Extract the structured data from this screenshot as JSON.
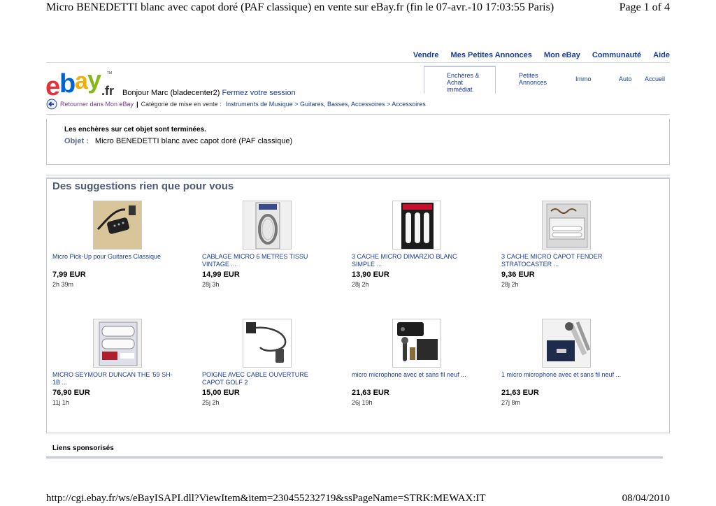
{
  "print": {
    "title": "Micro BENEDETTI blanc avec capot doré (PAF classique) en vente sur eBay.fr (fin le 07-avr.-10 17:03:55 Paris)",
    "page": "Page 1 of 4",
    "url": "http://cgi.ebay.fr/ws/eBayISAPI.dll?ViewItem&item=230455232719&ssPageName=STRK:MEWAX:IT",
    "date": "08/04/2010"
  },
  "topnav": {
    "sell": "Vendre",
    "my_listings": "Mes Petites Annonces",
    "my_ebay": "Mon eBay",
    "community": "Communauté",
    "help": "Aide"
  },
  "subnav": {
    "auctions_1": "Enchères &",
    "auctions_2": "Achat",
    "auctions_3": "immédiat",
    "classifieds_1": "Petites",
    "classifieds_2": "Annonces",
    "immo": "Immo",
    "auto": "Auto",
    "home": "Accueil"
  },
  "logo": {
    "text": "ebay.fr",
    "colors": {
      "e": "#e53238",
      "b": "#0064d2",
      "a": "#f5af02",
      "y": "#86b817"
    }
  },
  "greeting": {
    "hello": "Bonjour Marc (bladecenter2)",
    "signout": "Fermez votre session"
  },
  "breadcrumb": {
    "back": "Retourner dans Mon eBay",
    "separator": "|",
    "category_label": "Catégorie de mise en vente :",
    "path": "Instruments de Musique > Guitares, Basses, Accessoires > Accessoires"
  },
  "ended": {
    "title": "Les enchères sur cet objet sont terminées.",
    "object_label": "Objet :",
    "object_value": "Micro BENEDETTI blanc avec capot doré (PAF classique)"
  },
  "suggestions": {
    "title": "Des suggestions rien que pour vous",
    "items": [
      {
        "title": "Micro Pick-Up pour Guitares Classique",
        "price": "7,99 EUR",
        "time": "2h 39m"
      },
      {
        "title": "CABLAGE MICRO 6 METRES TISSU VINTAGE ...",
        "price": "14,99 EUR",
        "time": "28j 3h"
      },
      {
        "title": "3 CACHE MICRO DIMARZIO BLANC SIMPLE ...",
        "price": "13,90 EUR",
        "time": "28j 2h"
      },
      {
        "title": "3 CACHE MICRO CAPOT FENDER STRATOCASTER ...",
        "price": "9,36 EUR",
        "time": "28j 2h"
      },
      {
        "title": "MICRO SEYMOUR DUNCAN THE '59 SH-1B ...",
        "price": "76,90 EUR",
        "time": "11j 1h"
      },
      {
        "title": "POIGNE AVEC CABLE OUVERTURE CAPOT GOLF 2",
        "price": "15,00 EUR",
        "time": "25j 2h"
      },
      {
        "title": "micro microphone avec et sans fil neuf ...",
        "price": "21,63 EUR",
        "time": "26j 19h"
      },
      {
        "title": "1 micro microphone avec et sans fil neuf ...",
        "price": "21,63 EUR",
        "time": "27j 8m"
      }
    ]
  },
  "sponsored": {
    "title": "Liens sponsorisés"
  }
}
